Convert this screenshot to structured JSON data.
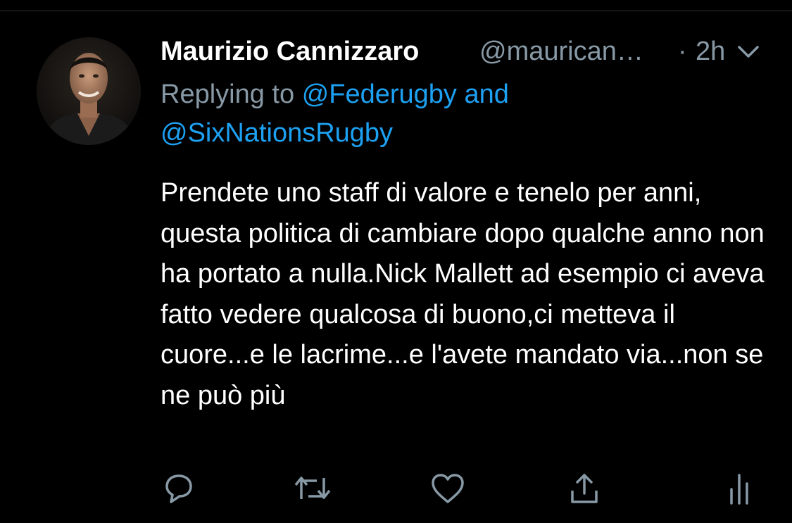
{
  "tweet": {
    "author_name": "Maurizio Cannizzaro",
    "author_handle": "@maurican…",
    "separator": "·",
    "timestamp": "2h",
    "reply_prefix": "Replying to",
    "mention_1": "@Federugby",
    "mention_joiner": "and",
    "mention_2": "@SixNationsRugby",
    "body": "Prendete uno staff di valore e tenelo per anni, questa politica di cambiare dopo qualche anno non ha portato a nulla.Nick Mallett ad esempio ci aveva fatto vedere qualcosa di buono,ci metteva il cuore...e le lacrime...e l'avete mandato via...non se ne può più"
  },
  "actions": {
    "reply_icon": "speech-bubble-icon",
    "retweet_icon": "retweet-arrows-icon",
    "like_icon": "heart-icon",
    "share_icon": "share-upload-icon",
    "analytics_icon": "bar-chart-icon"
  },
  "colors": {
    "background": "#000000",
    "text_primary": "#ffffff",
    "text_secondary": "#8899a6",
    "link": "#1da1f2",
    "icon": "#8899a6"
  }
}
